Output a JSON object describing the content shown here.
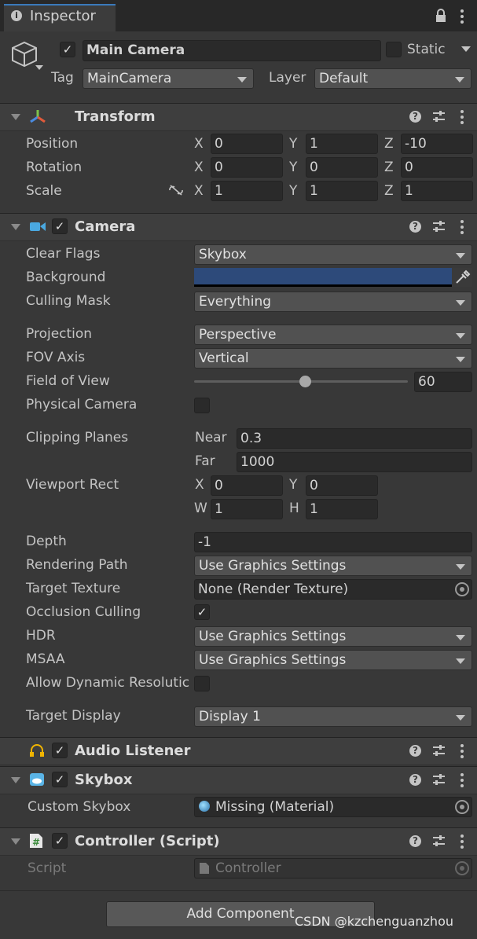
{
  "tab": {
    "title": "Inspector"
  },
  "object": {
    "name": "Main Camera",
    "active": true,
    "static_label": "Static",
    "tag_label": "Tag",
    "tag_value": "MainCamera",
    "layer_label": "Layer",
    "layer_value": "Default"
  },
  "transform": {
    "title": "Transform",
    "position_label": "Position",
    "rotation_label": "Rotation",
    "scale_label": "Scale",
    "axis_x": "X",
    "axis_y": "Y",
    "axis_z": "Z",
    "position": {
      "x": "0",
      "y": "1",
      "z": "-10"
    },
    "rotation": {
      "x": "0",
      "y": "0",
      "z": "0"
    },
    "scale": {
      "x": "1",
      "y": "1",
      "z": "1"
    }
  },
  "camera": {
    "title": "Camera",
    "enabled": true,
    "clear_flags_label": "Clear Flags",
    "clear_flags_value": "Skybox",
    "background_label": "Background",
    "background_color": "#2d4a7a",
    "culling_mask_label": "Culling Mask",
    "culling_mask_value": "Everything",
    "projection_label": "Projection",
    "projection_value": "Perspective",
    "fov_axis_label": "FOV Axis",
    "fov_axis_value": "Vertical",
    "fov_label": "Field of View",
    "fov_value": "60",
    "fov_slider_fraction": 0.52,
    "physical_label": "Physical Camera",
    "physical_checked": false,
    "clipping_label": "Clipping Planes",
    "near_label": "Near",
    "near_value": "0.3",
    "far_label": "Far",
    "far_value": "1000",
    "viewport_label": "Viewport Rect",
    "vp_x_label": "X",
    "vp_x": "0",
    "vp_y_label": "Y",
    "vp_y": "0",
    "vp_w_label": "W",
    "vp_w": "1",
    "vp_h_label": "H",
    "vp_h": "1",
    "depth_label": "Depth",
    "depth_value": "-1",
    "rendering_path_label": "Rendering Path",
    "rendering_path_value": "Use Graphics Settings",
    "target_texture_label": "Target Texture",
    "target_texture_value": "None (Render Texture)",
    "occlusion_label": "Occlusion Culling",
    "occlusion_checked": true,
    "hdr_label": "HDR",
    "hdr_value": "Use Graphics Settings",
    "msaa_label": "MSAA",
    "msaa_value": "Use Graphics Settings",
    "dynres_label": "Allow Dynamic Resolutic",
    "dynres_checked": false,
    "target_display_label": "Target Display",
    "target_display_value": "Display 1"
  },
  "audio_listener": {
    "title": "Audio Listener",
    "enabled": true
  },
  "skybox": {
    "title": "Skybox",
    "enabled": true,
    "custom_label": "Custom Skybox",
    "custom_value": "Missing (Material)"
  },
  "controller": {
    "title": "Controller (Script)",
    "enabled": true,
    "script_label": "Script",
    "script_value": "Controller"
  },
  "add_component_label": "Add Component",
  "watermark": "CSDN @kzchenguanzhou",
  "icons": {
    "tab": "info-icon",
    "lock": "lock-icon",
    "menu": "kebab-menu-icon",
    "gameobject": "cube-icon",
    "transform": "transform-axes-icon",
    "camera": "camera-icon",
    "audio": "headphones-icon",
    "skybox": "skybox-icon",
    "script": "script-icon",
    "help": "help-icon",
    "presets": "presets-icon",
    "eyedropper": "eyedropper-icon",
    "link": "unlinked-scale-icon"
  }
}
